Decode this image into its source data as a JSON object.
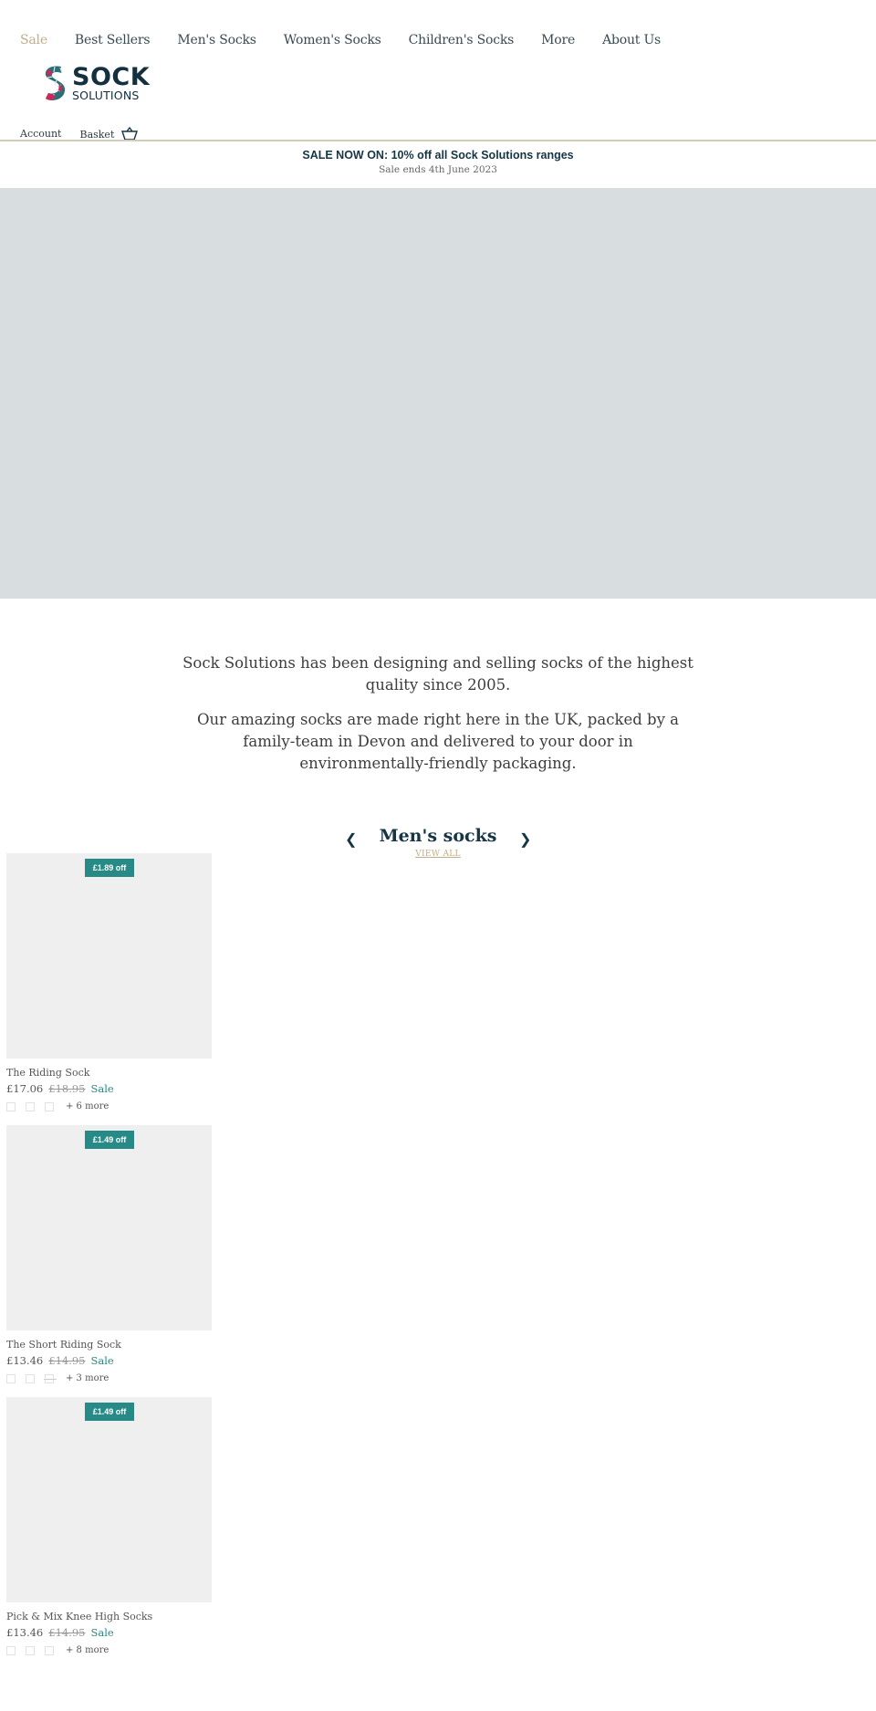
{
  "nav": {
    "items": [
      {
        "label": "Sale",
        "highlight": true
      },
      {
        "label": "Best Sellers"
      },
      {
        "label": "Men's Socks"
      },
      {
        "label": "Women's Socks"
      },
      {
        "label": "Children's Socks"
      },
      {
        "label": "More"
      },
      {
        "label": "About Us"
      }
    ]
  },
  "brand": {
    "line1": "SOCK",
    "line2": "SOLUTIONS"
  },
  "utility": {
    "account": "Account",
    "basket": "Basket"
  },
  "announcement": {
    "headline": "SALE NOW ON: 10% off all Sock Solutions ranges",
    "subline": "Sale ends 4th June 2023"
  },
  "intro": {
    "p1": "Sock Solutions has been designing and selling socks of the highest quality since 2005.",
    "p2": "Our amazing socks are made right here in the UK, packed by a family-team in Devon and delivered to your door in environmentally-friendly packaging."
  },
  "section": {
    "title": "Men's socks",
    "view_all": "VIEW ALL",
    "prev_icon": "chevron-left-icon",
    "next_icon": "chevron-right-icon"
  },
  "colors": {
    "accent": "#c2ad85",
    "brand": "#163545",
    "badge": "#288a86",
    "hero": "#d8dddf"
  },
  "products": [
    {
      "badge": "£1.89 off",
      "name": "The Riding Sock",
      "price": "£17.06",
      "was": "£18.95",
      "tag": "Sale",
      "more": "+ 6 more"
    },
    {
      "badge": "£1.49 off",
      "name": "The Short Riding Sock",
      "price": "£13.46",
      "was": "£14.95",
      "tag": "Sale",
      "more": "+ 3 more"
    },
    {
      "badge": "£1.49 off",
      "name": "Pick & Mix Knee High Socks",
      "price": "£13.46",
      "was": "£14.95",
      "tag": "Sale",
      "more": "+ 8 more"
    }
  ]
}
